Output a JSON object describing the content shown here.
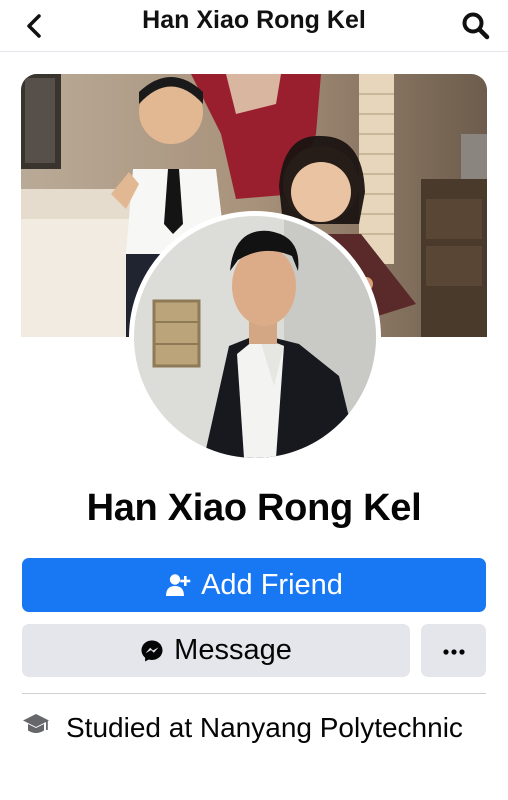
{
  "header": {
    "title": "Han Xiao Rong Kel"
  },
  "profile": {
    "name": "Han Xiao Rong Kel"
  },
  "actions": {
    "add_friend_label": "Add Friend",
    "message_label": "Message",
    "more_label": "•••"
  },
  "intro": {
    "prefix": "Studied at ",
    "school": "Nanyang Polytechnic"
  },
  "colors": {
    "primary": "#1877f2",
    "secondary_button": "#e4e6eb",
    "divider": "#ced0d4",
    "text": "#050505"
  },
  "icons": {
    "back": "chevron-left-icon",
    "search": "search-icon",
    "add_friend": "person-plus-icon",
    "message": "messenger-icon",
    "more": "ellipsis-icon",
    "education": "graduation-cap-icon"
  }
}
